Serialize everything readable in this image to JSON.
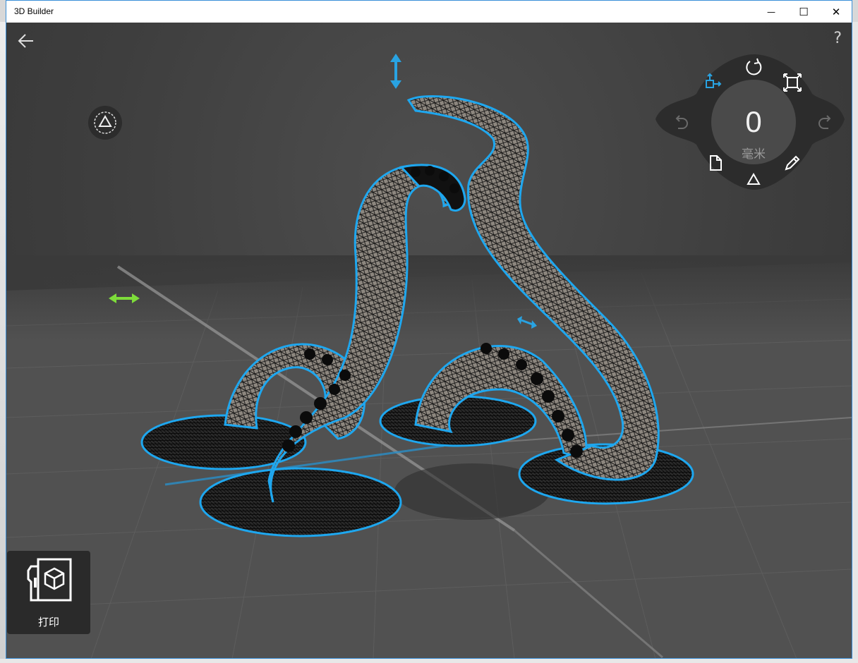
{
  "window": {
    "title": "3D Builder",
    "controls": {
      "minimize": "—",
      "maximize": "☐",
      "close": "✕"
    }
  },
  "toolbar": {
    "help_label": "?"
  },
  "hub": {
    "value": "0",
    "unit": "毫米"
  },
  "print": {
    "label": "打印"
  },
  "colors": {
    "accent": "#2aa6e6",
    "outline": "#1ea7ef",
    "axis_x": "#7ddc3a",
    "axis_y": "#29a3e2"
  },
  "icons": [
    "back-arrow-icon",
    "help-icon",
    "triangle-icon",
    "move-vertical-icon",
    "move-horizontal-icon",
    "rotate-icon",
    "scale-icon",
    "move-icon",
    "undo-icon",
    "redo-icon",
    "new-file-icon",
    "edit-icon",
    "print-icon"
  ]
}
